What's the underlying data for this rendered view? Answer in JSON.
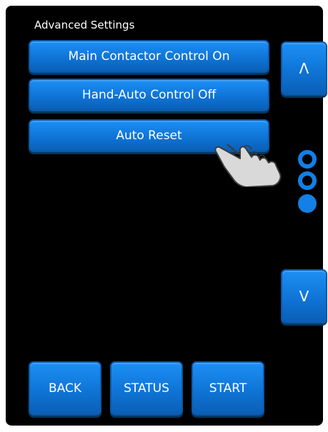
{
  "screen": {
    "title": "Advanced Settings"
  },
  "menu": {
    "items": [
      {
        "label": "Main Contactor Control On"
      },
      {
        "label": "Hand-Auto Control Off"
      },
      {
        "label": "Auto Reset"
      }
    ]
  },
  "scroll": {
    "up_label": "Λ",
    "down_label": "V"
  },
  "pagination": {
    "total": 3,
    "current": 3
  },
  "bottom_bar": {
    "back_label": "BACK",
    "status_label": "STATUS",
    "start_label": "START"
  },
  "icons": {
    "pointer": "pointing-hand-icon",
    "page_indicator": "page-dot-icon"
  },
  "colors": {
    "background": "#000000",
    "button_fill": "#1280e6",
    "button_text": "#ffffff"
  }
}
